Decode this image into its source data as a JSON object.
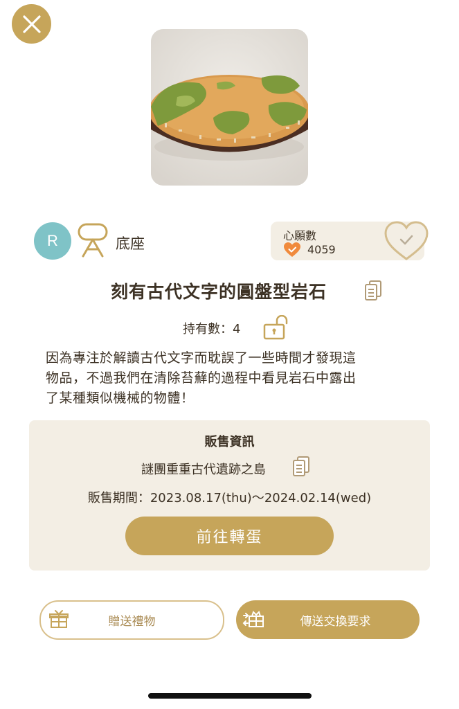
{
  "item": {
    "category": "底座",
    "rarity": "R",
    "title": "刻有古代文字的圓盤型岩石",
    "owned_label": "持有數：4",
    "description_lines": [
      "因為專注於解讀古代文字而耽誤了一些時間才發現這",
      "物品，不過我們在清除苔蘚的過程中看見岩石中露出",
      "了某種類似機械的物體！"
    ]
  },
  "wish": {
    "title": "心願數",
    "count": "4059"
  },
  "sales": {
    "title": "販售資訊",
    "location": "謎團重重古代遺跡之島",
    "period": "販售期間：2023.08.17(thu)～2024.02.14(wed)",
    "gacha_button": "前往轉蛋"
  },
  "actions": {
    "gift_label": "贈送禮物",
    "trade_label": "傳送交換要求"
  },
  "colors": {
    "accent": "#c6a55a",
    "rarity": "#7fc3c7",
    "panel": "#f3eee4"
  }
}
